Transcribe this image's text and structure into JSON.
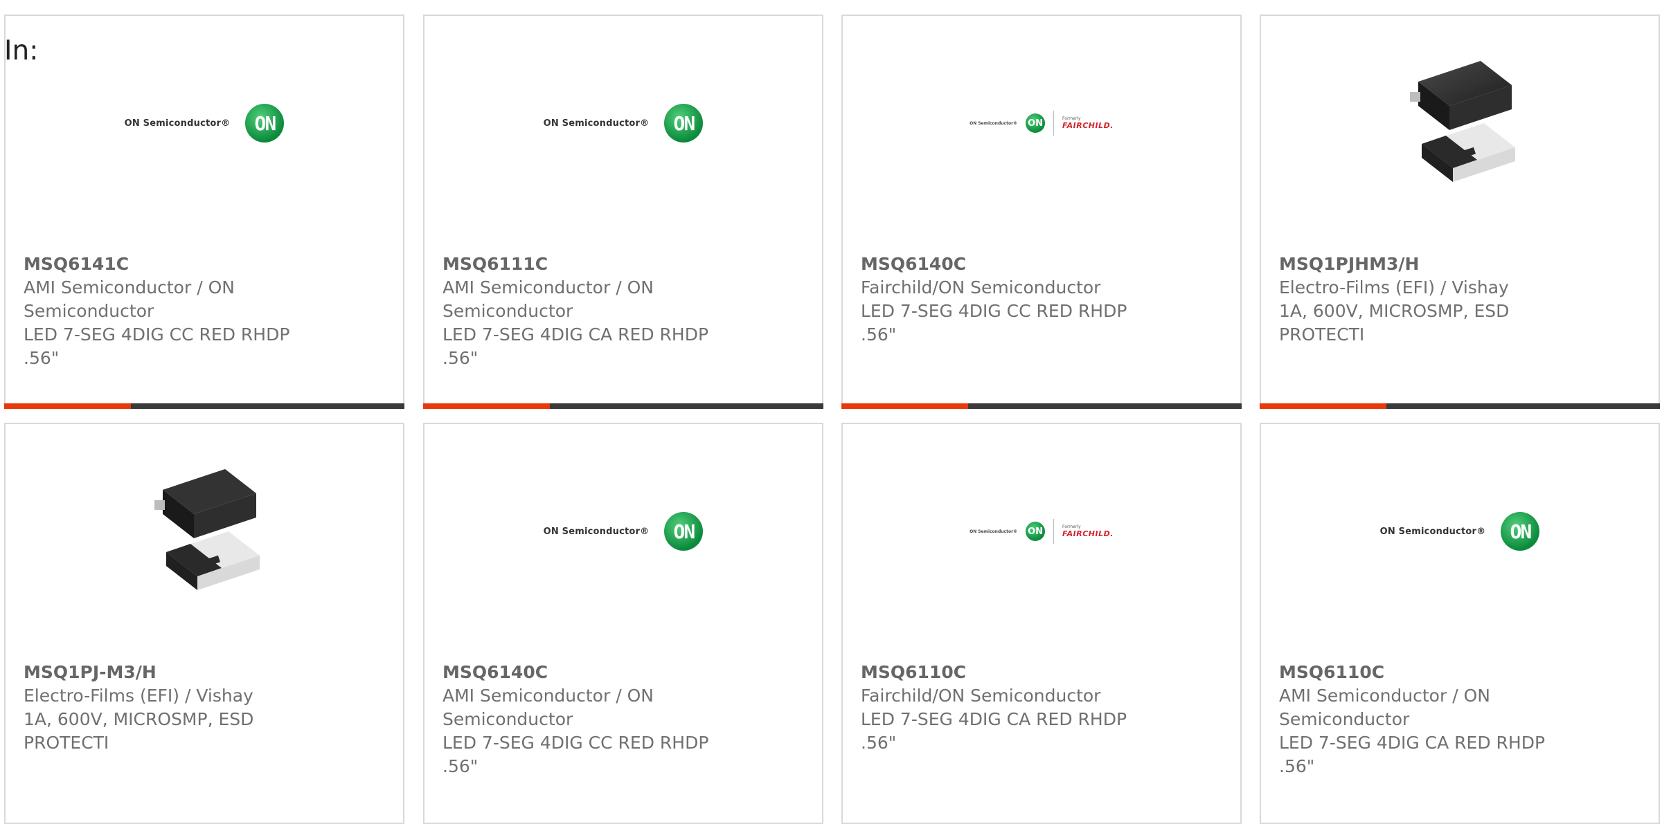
{
  "filter": {
    "label": "In:"
  },
  "logos": {
    "on": {
      "wordmark": "ON Semiconductor®",
      "mark": "ON"
    },
    "fairchild": {
      "formerly": "Formerly",
      "name": "FAIRCHILD."
    }
  },
  "colors": {
    "accent": "#e8390c",
    "bar": "#3a3a3a",
    "border": "#d9d9d9",
    "on_green": "#0b8a3c"
  },
  "products": [
    {
      "image": "on-semiconductor-logo",
      "part": "MSQ6141C",
      "manufacturer": "AMI Semiconductor / ON Semiconductor",
      "description": "LED 7-SEG 4DIG CC RED RHDP .56\""
    },
    {
      "image": "on-semiconductor-logo",
      "part": "MSQ6111C",
      "manufacturer": "AMI Semiconductor / ON Semiconductor",
      "description": "LED 7-SEG 4DIG CA RED RHDP .56\""
    },
    {
      "image": "on-fairchild-logo",
      "part": "MSQ6140C",
      "manufacturer": "Fairchild/ON Semiconductor",
      "description": "LED 7-SEG 4DIG CC RED RHDP .56\""
    },
    {
      "image": "diode-package-photo",
      "part": "MSQ1PJHM3/H",
      "manufacturer": "Electro-Films (EFI) / Vishay",
      "description": "1A, 600V, MICROSMP, ESD PROTECTI"
    },
    {
      "image": "diode-package-photo",
      "part": "MSQ1PJ-M3/H",
      "manufacturer": "Electro-Films (EFI) / Vishay",
      "description": "1A, 600V, MICROSMP, ESD PROTECTI"
    },
    {
      "image": "on-semiconductor-logo",
      "part": "MSQ6140C",
      "manufacturer": "AMI Semiconductor / ON Semiconductor",
      "description": "LED 7-SEG 4DIG CC RED RHDP .56\""
    },
    {
      "image": "on-fairchild-logo",
      "part": "MSQ6110C",
      "manufacturer": "Fairchild/ON Semiconductor",
      "description": "LED 7-SEG 4DIG CA RED RHDP .56\""
    },
    {
      "image": "on-semiconductor-logo",
      "part": "MSQ6110C",
      "manufacturer": "AMI Semiconductor / ON Semiconductor",
      "description": "LED 7-SEG 4DIG CA RED RHDP .56\""
    }
  ]
}
